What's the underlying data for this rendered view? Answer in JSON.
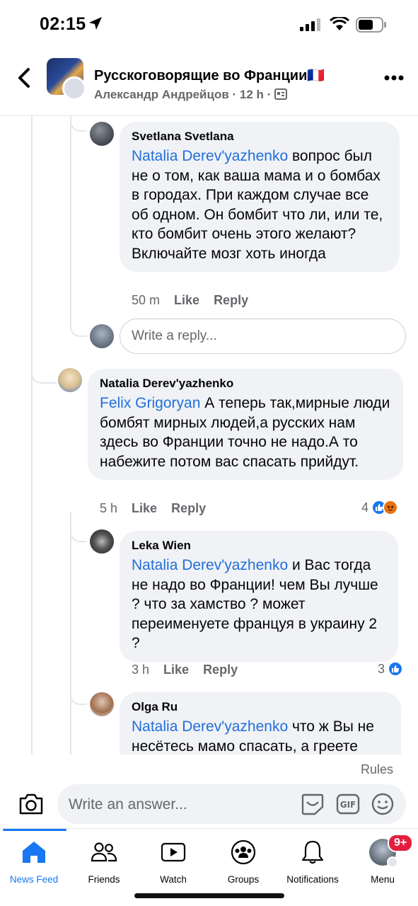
{
  "status_bar": {
    "time": "02:15"
  },
  "header": {
    "title": "Русскоговорящие во Франции🇫🇷",
    "subtitle": "Александр Андрейцов · 12 h ·"
  },
  "comments": [
    {
      "author": "Svetlana Svetlana",
      "mention": "Natalia Derev'yazhenko",
      "text": " вопрос был не о том, как ваша мама и о бомбах в городах. При каждом случае все об одном. Он бомбит что ли, или те, кто бомбит очень этого желают? Включайте мозг хоть иногда",
      "time": "50 m",
      "like": "Like",
      "reply": "Reply"
    },
    {
      "author": "Natalia Derev'yazhenko",
      "mention": "Felix Grigoryan",
      "text": " А теперь так,мирные люди бомбят мирных людей,а русских нам здесь во Франции точно не надо.А то набежите потом вас спасать прийдут.",
      "time": "5 h",
      "like": "Like",
      "reply": "Reply",
      "reactions": "4"
    },
    {
      "author": "Leka Wien",
      "mention": "Natalia Derev'yazhenko",
      "text": " и Вас тогда не надо во Франции! чем Вы лучше ? что за хамство ? может переименуете француя в украину 2 ?",
      "time": "3 h",
      "like": "Like",
      "reply": "Reply",
      "reactions": "3"
    },
    {
      "author": "Olga Ru",
      "mention": "Natalia Derev'yazhenko",
      "text": " что ж Вы не несётесь мамо спасать, а греете"
    }
  ],
  "reply_placeholder": "Write a reply...",
  "rules": "Rules",
  "composer": {
    "placeholder": "Write an answer..."
  },
  "tabs": [
    {
      "label": "News Feed",
      "icon": "home-icon"
    },
    {
      "label": "Friends",
      "icon": "friends-icon"
    },
    {
      "label": "Watch",
      "icon": "watch-icon"
    },
    {
      "label": "Groups",
      "icon": "groups-icon"
    },
    {
      "label": "Notifications",
      "icon": "bell-icon"
    },
    {
      "label": "Menu",
      "icon": "menu-avatar"
    }
  ],
  "menu_badge": "9+",
  "colors": {
    "accent": "#1877f2",
    "mention": "#216fdb",
    "bubble": "#f0f2f5",
    "badge": "#e41e3f"
  }
}
